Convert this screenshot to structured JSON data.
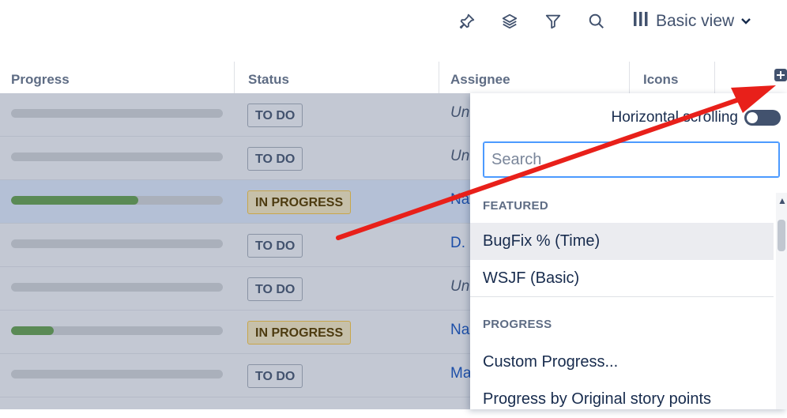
{
  "toolbar": {
    "icons": [
      "pin-icon",
      "layers-icon",
      "filter-icon",
      "search-icon",
      "columns-icon",
      "chevron-down-icon"
    ],
    "view_label": "Basic view"
  },
  "table": {
    "columns": [
      "Progress",
      "Status",
      "Assignee",
      "Icons"
    ],
    "rows": [
      {
        "progress": 0.0,
        "status": "TO DO",
        "assignee": "Un"
      },
      {
        "progress": 0.0,
        "status": "TO DO",
        "assignee": "Un"
      },
      {
        "progress": 0.6,
        "status": "IN PROGRESS",
        "assignee": "Na"
      },
      {
        "progress": 0.0,
        "status": "TO DO",
        "assignee": "D."
      },
      {
        "progress": 0.0,
        "status": "TO DO",
        "assignee": "Un"
      },
      {
        "progress": 0.2,
        "status": "IN PROGRESS",
        "assignee": "Na"
      },
      {
        "progress": 0.0,
        "status": "TO DO",
        "assignee": "Ma"
      }
    ]
  },
  "panel": {
    "horizontal_scrolling_label": "Horizontal scrolling",
    "horizontal_scrolling_on": false,
    "search_placeholder": "Search",
    "sections": [
      {
        "title": "FEATURED",
        "items": [
          "BugFix % (Time)",
          "WSJF (Basic)"
        ]
      },
      {
        "title": "PROGRESS",
        "items": [
          "Custom Progress...",
          "Progress by Original story points"
        ]
      }
    ]
  },
  "colors": {
    "progress_fill": "#5a8a55",
    "selected_row": "#b4c0d6",
    "annotation_arrow": "#e8201a"
  }
}
